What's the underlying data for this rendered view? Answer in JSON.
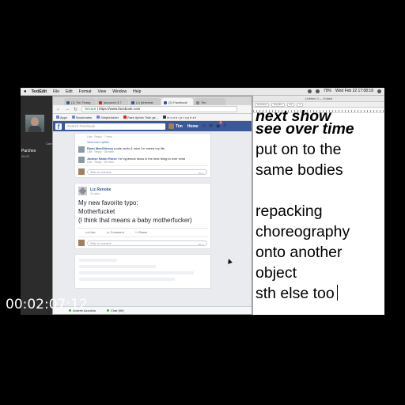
{
  "menubar": {
    "app_name": "TextEdit",
    "items": [
      "File",
      "Edit",
      "Format",
      "View",
      "Window",
      "Help"
    ],
    "clock": "Wed Feb 22 17:08:18",
    "battery": "79%"
  },
  "call": {
    "status": "Current Call",
    "name": "Parches",
    "duration": "05:03"
  },
  "browser": {
    "tabs": [
      {
        "label": "(1) Tim Teang",
        "icon": "facebook-icon"
      },
      {
        "label": "lacowore 3.7",
        "icon": "youtube-icon"
      },
      {
        "label": "(1) (timemar",
        "icon": "facebook-icon"
      },
      {
        "label": "(2) Facebook",
        "icon": "facebook-icon"
      },
      {
        "label": "Tim",
        "icon": "page-icon"
      }
    ],
    "address": {
      "secure": "Secure",
      "url": "https://www.facebook.com"
    },
    "bookmarks": [
      "Apps",
      "Bookmarks",
      "SimpleAdder",
      "Rare Aphex Twin ge...",
      "m o n k • p r o p h e t"
    ]
  },
  "facebook": {
    "search_placeholder": "Search Facebook",
    "user_name": "Tim",
    "home_label": "Home",
    "notification_count": "2",
    "comments": [
      {
        "meta": "Like · Reply · 7 mins"
      },
      {
        "author": "Ryan MacGlinsey",
        "text": "posts radio & mice I'm saved my life",
        "meta": "Like · Reply · 38 mins"
      },
      {
        "author": "Janese Sarah Rinse",
        "text": "I'm hypercub show is the best thing to ever exist",
        "meta": "Like · Reply · 40 mins"
      }
    ],
    "view_more": "View more replies",
    "write_comment": "Write a comment...",
    "post": {
      "author": "Liz Renoke",
      "time": "11 mins",
      "lines": [
        "My new favorite typo:",
        "Motherfucket",
        "(I think that means a baby motherfucker)"
      ],
      "actions": [
        "Like",
        "Comment",
        "Share"
      ]
    },
    "bottom_bar": {
      "contact": "Andrée Azzolina",
      "chat": "Chat (69)"
    }
  },
  "textedit": {
    "title": "Untitled 3 — Edited",
    "toolbar": [
      "Helvetica",
      "Regular",
      "12",
      "a"
    ],
    "lines": [
      {
        "text": "next show",
        "style": "bold-italic"
      },
      {
        "text": "see over time",
        "style": "bold-italic"
      },
      {
        "text": "put on to the",
        "style": "normal"
      },
      {
        "text": "same bodies",
        "style": "normal"
      },
      {
        "text": "",
        "style": "normal"
      },
      {
        "text": "repacking",
        "style": "normal"
      },
      {
        "text": "choreography",
        "style": "normal"
      },
      {
        "text": "onto another",
        "style": "normal"
      },
      {
        "text": "object",
        "style": "normal"
      },
      {
        "text": "sth else too",
        "style": "normal"
      }
    ]
  },
  "overlay": {
    "timecode": "00:02:07;12"
  },
  "colors": {
    "facebook_blue": "#3b5998",
    "call_info": "#1e88e5",
    "call_end": "#e53935"
  }
}
